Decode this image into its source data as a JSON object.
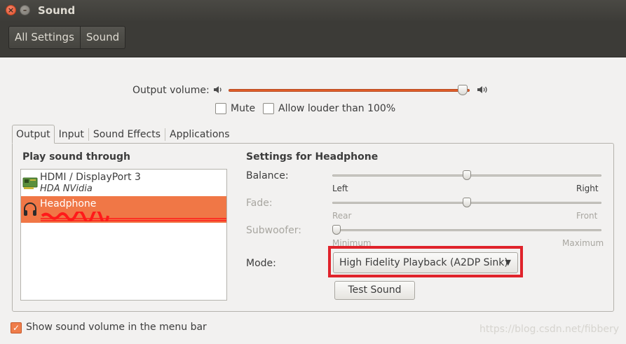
{
  "window": {
    "title": "Sound"
  },
  "toolbar": {
    "crumbs": [
      "All Settings",
      "Sound"
    ]
  },
  "output_volume": {
    "label": "Output volume:",
    "level": 0.99,
    "mute_label": "Mute",
    "mute_checked": false,
    "louder_label": "Allow louder than 100%",
    "louder_checked": false
  },
  "tabs": [
    "Output",
    "Input",
    "Sound Effects",
    "Applications"
  ],
  "active_tab": "Output",
  "play_through": {
    "title": "Play sound through",
    "devices": [
      {
        "name": "HDMI / DisplayPort 3",
        "sub": "HDA NVidia",
        "icon": "hdmi-card-icon",
        "selected": false
      },
      {
        "name": "Headphone",
        "sub": "",
        "icon": "headphone-icon",
        "selected": true
      }
    ]
  },
  "settings": {
    "title": "Settings for Headphone",
    "balance": {
      "label": "Balance:",
      "left": "Left",
      "right": "Right",
      "level": 0.5
    },
    "fade": {
      "label": "Fade:",
      "left": "Rear",
      "right": "Front",
      "level": 0.5,
      "disabled": true
    },
    "subwoofer": {
      "label": "Subwoofer:",
      "left": "Minimum",
      "right": "Maximum",
      "level": 0.0,
      "disabled": true
    },
    "mode": {
      "label": "Mode:",
      "value": "High Fidelity Playback (A2DP Sink)"
    },
    "test_button": "Test Sound"
  },
  "footer": {
    "show_volume_label": "Show sound volume in the menu bar",
    "show_volume_checked": true
  },
  "watermark": "https://blog.csdn.net/fibbery",
  "colors": {
    "accent": "#f07746",
    "highlight_box": "#e0232b",
    "titlebar": "#3c3b37"
  }
}
